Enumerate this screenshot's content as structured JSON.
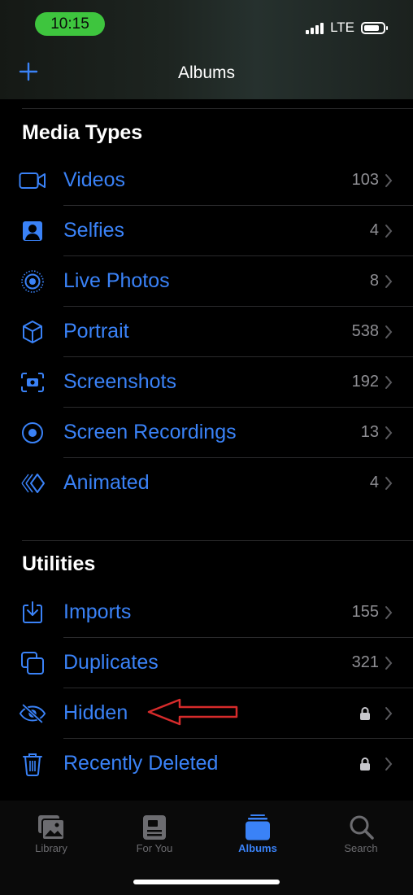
{
  "status_bar": {
    "time": "10:15",
    "network": "LTE"
  },
  "nav": {
    "title": "Albums",
    "add_icon": "plus-icon"
  },
  "sections": {
    "media_types": {
      "title": "Media Types",
      "items": [
        {
          "label": "Videos",
          "count": "103",
          "icon": "video-icon"
        },
        {
          "label": "Selfies",
          "count": "4",
          "icon": "selfie-icon"
        },
        {
          "label": "Live Photos",
          "count": "8",
          "icon": "live-photos-icon"
        },
        {
          "label": "Portrait",
          "count": "538",
          "icon": "cube-icon"
        },
        {
          "label": "Screenshots",
          "count": "192",
          "icon": "screenshot-icon"
        },
        {
          "label": "Screen Recordings",
          "count": "13",
          "icon": "record-icon"
        },
        {
          "label": "Animated",
          "count": "4",
          "icon": "animated-icon"
        }
      ]
    },
    "utilities": {
      "title": "Utilities",
      "items": [
        {
          "label": "Imports",
          "count": "155",
          "icon": "import-icon"
        },
        {
          "label": "Duplicates",
          "count": "321",
          "icon": "duplicates-icon"
        },
        {
          "label": "Hidden",
          "count": "",
          "icon": "eye-slash-icon",
          "locked": true
        },
        {
          "label": "Recently Deleted",
          "count": "",
          "icon": "trash-icon",
          "locked": true
        }
      ]
    }
  },
  "tabbar": {
    "tabs": [
      {
        "label": "Library",
        "icon": "library-icon"
      },
      {
        "label": "For You",
        "icon": "for-you-icon"
      },
      {
        "label": "Albums",
        "icon": "albums-icon",
        "active": true
      },
      {
        "label": "Search",
        "icon": "search-icon"
      }
    ]
  },
  "colors": {
    "accent": "#3a82f7",
    "annotation_arrow": "#d62b2b",
    "time_pill": "#3ec53e"
  }
}
